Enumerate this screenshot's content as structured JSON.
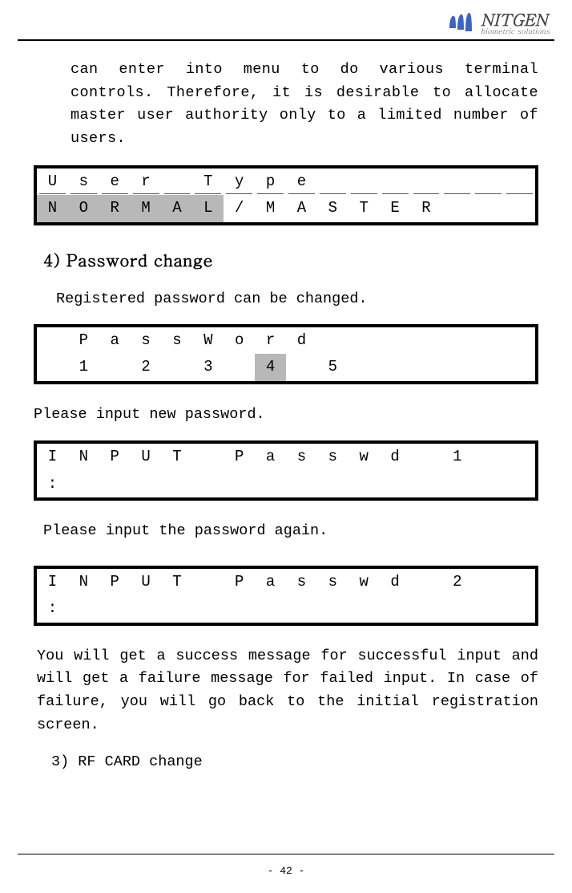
{
  "logo": {
    "brand": "NITGEN",
    "tag": "biometric solutions"
  },
  "para_top": "can enter into menu to do various terminal controls. Therefore, it is desirable to allocate master user authority only to a limited number of users.",
  "lcd_user_type": {
    "row1": [
      "U",
      "s",
      "e",
      "r",
      " ",
      "T",
      "y",
      "p",
      "e",
      "",
      "",
      "",
      "",
      "",
      "",
      ""
    ],
    "row2": [
      "N",
      "O",
      "R",
      "M",
      "A",
      "L",
      "/",
      "M",
      "A",
      "S",
      "T",
      "E",
      "R",
      "",
      "",
      ""
    ],
    "row2_shaded_upto": 6
  },
  "section4_heading": "4) Password change",
  "section4_text": "Registered password can be changed.",
  "lcd_password": {
    "row1": [
      "",
      "P",
      "a",
      "s",
      "s",
      "W",
      "o",
      "r",
      "d",
      "",
      "",
      "",
      "",
      "",
      "",
      ""
    ],
    "row2": [
      "",
      "1",
      "",
      "2",
      "",
      "3",
      "",
      "4",
      "",
      "5",
      "",
      "",
      "",
      "",
      "",
      ""
    ],
    "row2_shaded_indices": [
      7
    ]
  },
  "please_input_new": "Please input new password.",
  "lcd_input1": {
    "row1": [
      "I",
      "N",
      "P",
      "U",
      "T",
      "",
      "P",
      "a",
      "s",
      "s",
      "w",
      "d",
      "",
      "1",
      "",
      ""
    ],
    "row2": [
      ":",
      "",
      "",
      "",
      "",
      "",
      "",
      "",
      "",
      "",
      "",
      "",
      "",
      "",
      "",
      ""
    ]
  },
  "please_input_again": "Please input the password again.",
  "lcd_input2": {
    "row1": [
      "I",
      "N",
      "P",
      "U",
      "T",
      "",
      "P",
      "a",
      "s",
      "s",
      "w",
      "d",
      "",
      "2",
      "",
      ""
    ],
    "row2": [
      ":",
      "",
      "",
      "",
      "",
      "",
      "",
      "",
      "",
      "",
      "",
      "",
      "",
      "",
      "",
      ""
    ]
  },
  "result_para": "You will get a success message for successful input and will get a failure message for failed input. In case of failure, you will go back to the initial registration screen.",
  "section3_heading": "3) RF CARD change",
  "page_number": "- 42 -"
}
